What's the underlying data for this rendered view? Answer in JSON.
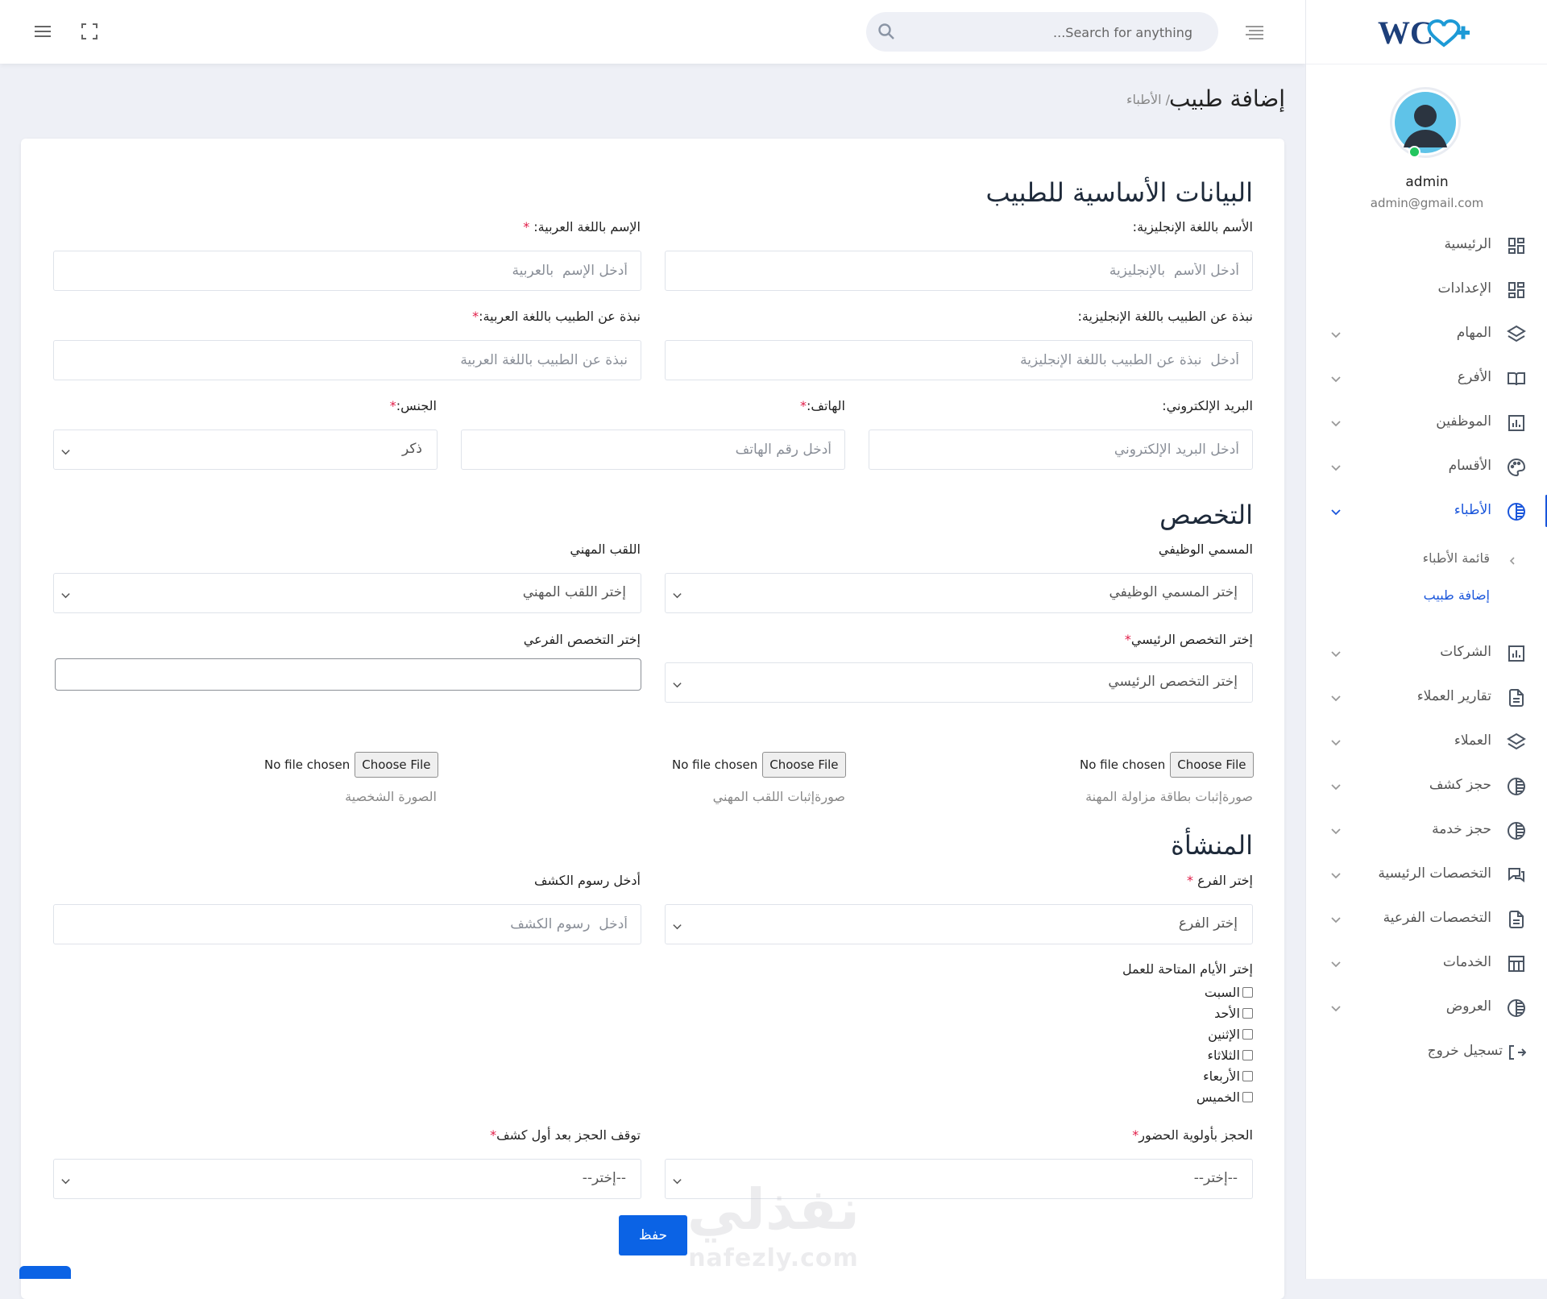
{
  "topbar": {
    "search_placeholder": "Search for anything..."
  },
  "sidebar": {
    "logo_text": "WC",
    "user": {
      "name": "admin",
      "email": "admin@gmail.com"
    },
    "items": [
      {
        "label": "الرئيسية",
        "icon": "dashboard-icon"
      },
      {
        "label": "الإعدادات",
        "icon": "settings-grid-icon"
      },
      {
        "label": "المهام",
        "icon": "layers-icon"
      },
      {
        "label": "الأفرع",
        "icon": "book-icon"
      },
      {
        "label": "الموظفين",
        "icon": "bar-chart-icon"
      },
      {
        "label": "الأقسام",
        "icon": "palette-icon"
      },
      {
        "label": "الأطباء",
        "icon": "globe-icon",
        "active": true
      },
      {
        "label": "الشركات",
        "icon": "bar-chart-icon"
      },
      {
        "label": "تقارير العملاء",
        "icon": "document-icon"
      },
      {
        "label": "العملاء",
        "icon": "layers-icon"
      },
      {
        "label": "حجز كشف",
        "icon": "globe-icon"
      },
      {
        "label": "حجز خدمة",
        "icon": "globe-icon"
      },
      {
        "label": "التخصصات الرئيسية",
        "icon": "chat-icon"
      },
      {
        "label": "التخصصات الفرعية",
        "icon": "document-icon"
      },
      {
        "label": "الخدمات",
        "icon": "table-icon"
      },
      {
        "label": "العروض",
        "icon": "globe-icon"
      }
    ],
    "sub_items": [
      {
        "label": "قائمة الأطباء"
      },
      {
        "label": "إضافة طبيب",
        "active": true
      }
    ],
    "logout_label": "تسجيل خروج"
  },
  "page": {
    "title": "إضافة طبيب",
    "breadcrumb": "/ الأطباء"
  },
  "form": {
    "section_basic": "البيانات الأساسية للطبيب",
    "name_en_label": "الأسم باللغة الإنجليزية:",
    "name_en_placeholder": "أدخل الأسم  بالإنجليزية",
    "name_ar_label": "الإسم باللغة العربية:",
    "name_ar_placeholder": "أدخل الإسم  بالعربية",
    "bio_en_label": "نبذة عن الطبيب باللغة الإنجليزية:",
    "bio_en_placeholder": "أدخل  نبذة عن الطبيب باللغة الإنجليزية",
    "bio_ar_label": "نبذة عن الطبيب باللغة العربية:",
    "bio_ar_placeholder": "نبذة عن الطبيب باللغة العربية",
    "email_label": "البريد الإلكتروني:",
    "email_placeholder": "أدخل البريد الإلكتروني",
    "phone_label": "الهاتف:",
    "phone_placeholder": "أدخل رقم الهاتف",
    "gender_label": "الجنس:",
    "gender_value": "ذكر",
    "section_spec": "التخصص",
    "job_title_label": "المسمي الوظيفي",
    "job_title_value": "إختر المسمي الوظيفي",
    "prof_title_label": "اللقب المهني",
    "prof_title_value": "إختر اللقب المهني",
    "main_spec_label": "إختر التخصص الرئيسي",
    "main_spec_value": "إختر التخصص الرئيسي",
    "sub_spec_label": "إختر التخصص الفرعي",
    "choose_file": "Choose File",
    "no_file": "No file chosen",
    "license_caption": "صورةإثبات بطاقة مزاولة المهنة",
    "prof_title_proof_caption": "صورةإثبات اللقب المهني",
    "photo_caption": "الصورة الشخصية",
    "section_facility": "المنشأة",
    "branch_label": "إختر الفرع",
    "branch_value": "إختر الفرع",
    "fee_label": "أدخل رسوم الكشف",
    "fee_placeholder": "أدخل  رسوم الكشف",
    "days_label": "إختر الأيام المتاحة للعمل",
    "days": [
      "السبت",
      "الأحد",
      "الإثنين",
      "الثلاثاء",
      "الأربعاء",
      "الخميس"
    ],
    "priority_label": "الحجز بأولوية الحضور",
    "priority_value": "--إختر--",
    "stop_label": "توقف الحجز بعد أول كشف",
    "stop_value": "--إختر--",
    "required_mark": "*",
    "save_label": "حفظ"
  },
  "watermark": {
    "arabic": "نفذلي",
    "latin": "nafezly.com"
  },
  "colors": {
    "accent": "#1a56db",
    "button": "#0b63e5",
    "required": "#e11d48"
  }
}
